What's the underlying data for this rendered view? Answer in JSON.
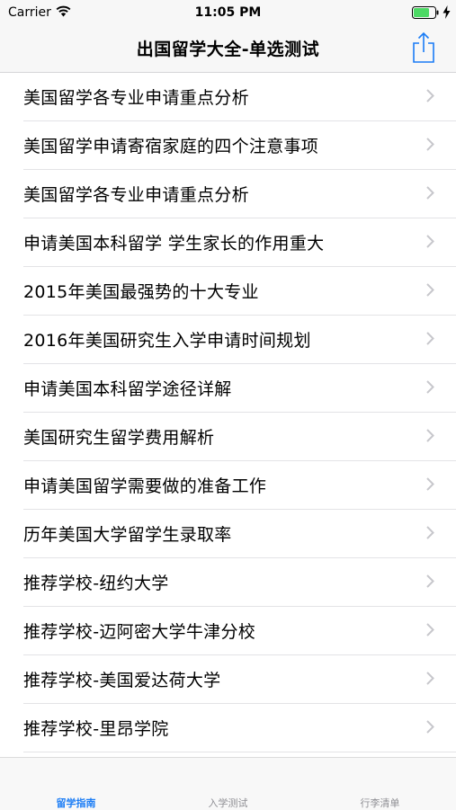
{
  "status_bar": {
    "carrier": "Carrier",
    "time": "11:05 PM",
    "icons": [
      "wifi-icon",
      "battery-icon",
      "charging-bolt-icon"
    ]
  },
  "nav_bar": {
    "title": "出国留学大全-单选测试",
    "share_icon": "share-icon",
    "accent_color": "#1a7cf5"
  },
  "list": {
    "items": [
      {
        "label": "美国留学各专业申请重点分析"
      },
      {
        "label": "美国留学申请寄宿家庭的四个注意事项"
      },
      {
        "label": "美国留学各专业申请重点分析"
      },
      {
        "label": "申请美国本科留学 学生家长的作用重大"
      },
      {
        "label": "2015年美国最强势的十大专业"
      },
      {
        "label": "2016年美国研究生入学申请时间规划"
      },
      {
        "label": "申请美国本科留学途径详解"
      },
      {
        "label": "美国研究生留学费用解析"
      },
      {
        "label": "申请美国留学需要做的准备工作"
      },
      {
        "label": "历年美国大学留学生录取率"
      },
      {
        "label": "推荐学校-纽约大学"
      },
      {
        "label": "推荐学校-迈阿密大学牛津分校"
      },
      {
        "label": "推荐学校-美国爱达荷大学"
      },
      {
        "label": "推荐学校-里昂学院"
      }
    ],
    "row_icon": "chevron-right-icon"
  },
  "tab_bar": {
    "tabs": [
      {
        "label": "留学指南",
        "active": true
      },
      {
        "label": "入学测试",
        "active": false
      },
      {
        "label": "行李清单",
        "active": false
      }
    ]
  }
}
